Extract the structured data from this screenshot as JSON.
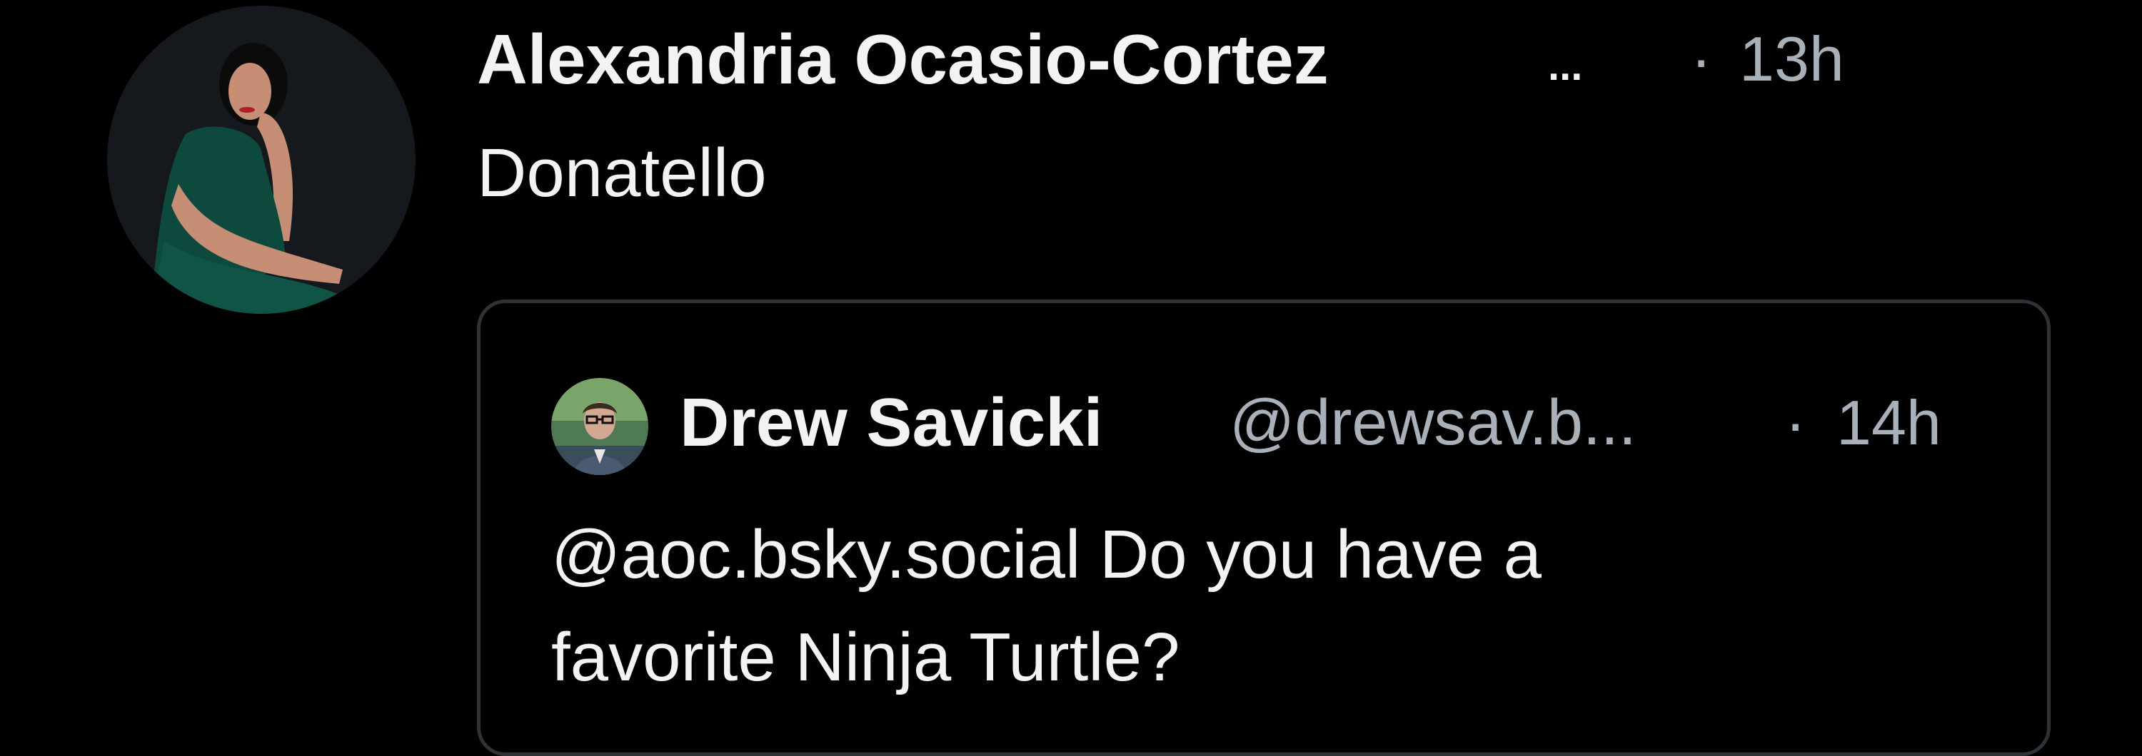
{
  "post": {
    "display_name": "Alexandria Ocasio-Cortez",
    "name_truncation": "...",
    "separator": "·",
    "timestamp": "13h",
    "text": "Donatello",
    "avatar_icon": "portrait-photo"
  },
  "quote": {
    "display_name": "Drew Savicki",
    "handle": "@drewsav.b...",
    "separator": "·",
    "timestamp": "14h",
    "text": "@aoc.bsky.social Do you have a\nfavorite Ninja Turtle?",
    "avatar_icon": "portrait-photo"
  },
  "colors": {
    "background": "#000000",
    "primary_text": "#f1f3f5",
    "secondary_text": "#a8b0ba",
    "card_border": "#2e3338"
  }
}
